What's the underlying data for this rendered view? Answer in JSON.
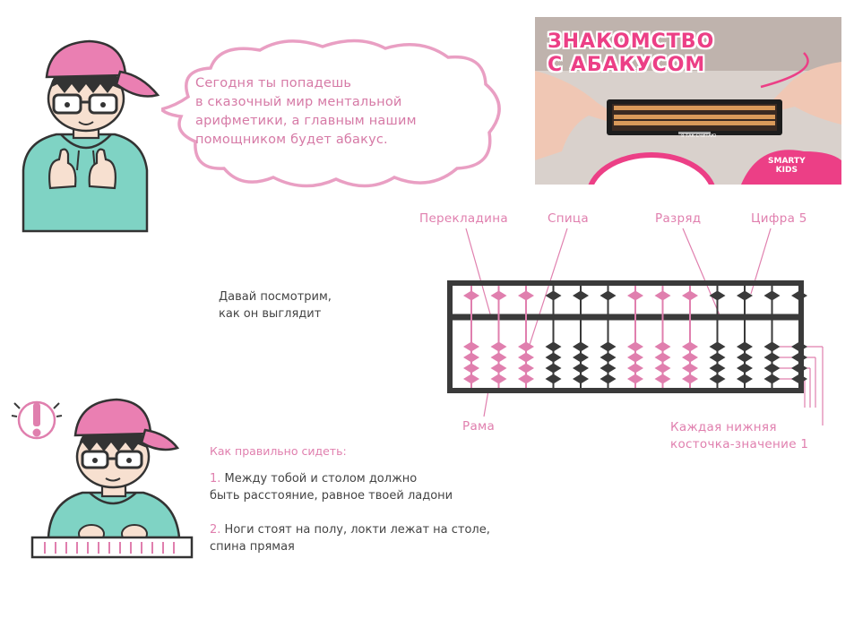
{
  "intro": {
    "cloud_lines": [
      "Сегодня ты попадешь",
      "в сказочный мир ментальной",
      "арифметики, а главным нашим",
      "помощником будет абакус."
    ]
  },
  "banner": {
    "title_line1": "ЗНАКОМСТВО",
    "title_line2": "С АБАКУСОМ",
    "brand_line1": "SMARTY",
    "brand_line2": "KIDS",
    "abacus_caption": "Я ТАК СЧИТАЮ"
  },
  "labels": {
    "perekladina": "Перекладина",
    "spica": "Спица",
    "razryad": "Разряд",
    "cifra5": "Цифра 5",
    "rama": "Рама",
    "lower_line1": "Каждая нижняя",
    "lower_line2": "косточка-значение 1"
  },
  "look": {
    "line1": "Давай посмотрим,",
    "line2": "как он выглядит"
  },
  "sitting": {
    "title": "Как правильно сидеть:",
    "item1_num": "1.",
    "item1_line1": "Между тобой и столом должно",
    "item1_line2": "быть расстояние, равное твоей ладони",
    "item2_num": "2.",
    "item2_line1": "Ноги стоят на полу, локти лежат на столе,",
    "item2_line2": "спина прямая"
  },
  "colors": {
    "pink": "#e07fae",
    "dark": "#3a3a3a",
    "teal": "#7fd3c4",
    "cap": "#ea7fb2"
  },
  "abacus": {
    "rods": 13,
    "pink_rods": [
      0,
      1,
      2,
      6,
      7,
      8
    ],
    "lower_beads_per_rod": 4
  }
}
